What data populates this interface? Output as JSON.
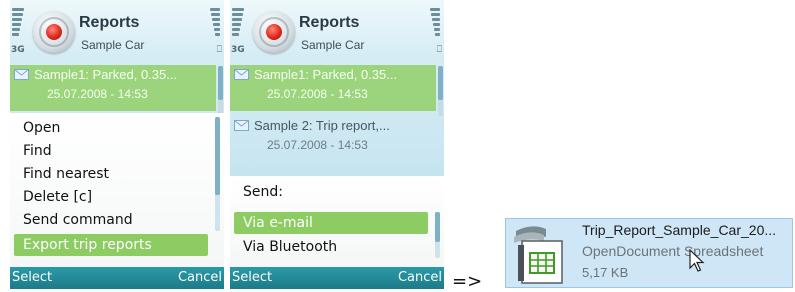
{
  "screen1": {
    "app_title": "Reports",
    "app_subtitle": "Sample Car",
    "network": "3G",
    "indicator": "⎕",
    "rows": [
      {
        "title": "Sample1: Parked, 0.35...",
        "date": "25.07.2008 - 14:53",
        "highlighted": true
      }
    ],
    "menu": [
      {
        "label": "Open"
      },
      {
        "label": "Find"
      },
      {
        "label": "Find nearest"
      },
      {
        "label": "Delete [c]"
      },
      {
        "label": "Send command"
      },
      {
        "label": "Export trip reports",
        "selected": true
      }
    ],
    "softkeys": {
      "left": "Select",
      "right": "Cancel"
    }
  },
  "screen2": {
    "app_title": "Reports",
    "app_subtitle": "Sample Car",
    "network": "3G",
    "indicator": "⎕",
    "rows": [
      {
        "title": "Sample1: Parked, 0.35...",
        "date": "25.07.2008 - 14:53",
        "highlighted": true
      },
      {
        "title": "Sample 2: Trip report,...",
        "date": "25.07.2008 - 14:53",
        "highlighted": false
      }
    ],
    "send_heading": "Send:",
    "menu": [
      {
        "label": "Via e-mail",
        "selected": true
      },
      {
        "label": "Via Bluetooth"
      }
    ],
    "softkeys": {
      "left": "Select",
      "right": "Cancel"
    }
  },
  "arrow": "=>",
  "file": {
    "name": "Trip_Report_Sample_Car_20...",
    "type": "OpenDocument Spreadsheet",
    "size": "5,17 KB",
    "icon": "spreadsheet-file-icon"
  },
  "colors": {
    "highlight": "#9cd47d",
    "selection": "#8dcc63",
    "softkey_bar": "#1d7b88",
    "file_box": "#cfe6f6"
  }
}
